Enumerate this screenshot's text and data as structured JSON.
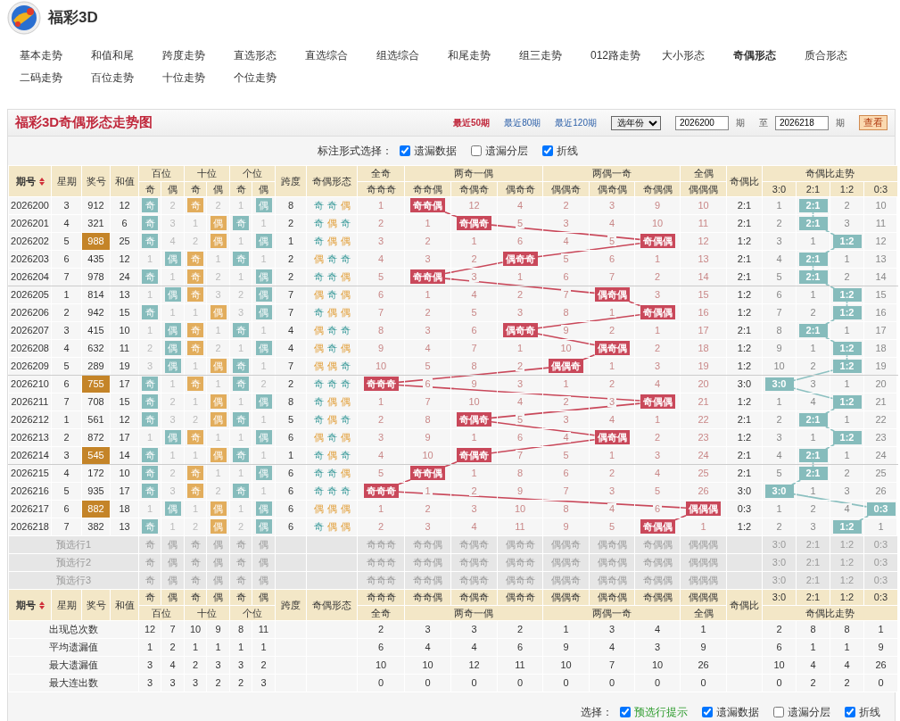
{
  "site": {
    "title": "福彩3D"
  },
  "nav": [
    {
      "label": "基本走势",
      "selected": false
    },
    {
      "label": "和值和尾",
      "selected": false
    },
    {
      "label": "跨度走势",
      "selected": false
    },
    {
      "label": "直选形态",
      "selected": false
    },
    {
      "label": "直选综合",
      "selected": false
    },
    {
      "label": "组选综合",
      "selected": false
    },
    {
      "label": "和尾走势",
      "selected": false
    },
    {
      "label": "组三走势",
      "selected": false
    },
    {
      "label": "012路走势",
      "selected": false
    },
    {
      "label": "大小形态",
      "selected": false
    },
    {
      "label": "奇偶形态",
      "selected": true
    },
    {
      "label": "质合形态",
      "selected": false
    },
    {
      "label": "二码走势",
      "selected": false
    },
    {
      "label": "百位走势",
      "selected": false
    },
    {
      "label": "十位走势",
      "selected": false
    },
    {
      "label": "个位走势",
      "selected": false
    }
  ],
  "panel": {
    "title": "福彩3D奇偶形态走势图",
    "ranges": [
      {
        "label": "最近50期",
        "selected": true
      },
      {
        "label": "最近80期",
        "selected": false
      },
      {
        "label": "最近120期",
        "selected": false
      }
    ],
    "year_select": "选年份",
    "from": "2026200",
    "from_unit": "期",
    "to_label": "至",
    "to": "2026218",
    "to_unit": "期",
    "query_button": "查看"
  },
  "mark_options": {
    "label": "标注形式选择：",
    "options": [
      {
        "kind": "miss",
        "label": "遗漏数据",
        "checked": true
      },
      {
        "kind": "layer",
        "label": "遗漏分层",
        "checked": false
      },
      {
        "kind": "polyline",
        "label": "折线",
        "checked": true
      }
    ]
  },
  "table": {
    "head": {
      "kind": "top",
      "period": "期号",
      "weekday": "星期",
      "number": "奖号",
      "sum": "和值",
      "positions": [
        {
          "label": "百位",
          "cols": [
            "奇",
            "偶"
          ]
        },
        {
          "label": "十位",
          "cols": [
            "奇",
            "偶"
          ]
        },
        {
          "label": "个位",
          "cols": [
            "奇",
            "偶"
          ]
        }
      ],
      "span": "跨度",
      "form": "奇偶形态",
      "groups": [
        {
          "label": "全奇",
          "cols": [
            "奇奇奇"
          ]
        },
        {
          "label": "两奇一偶",
          "cols": [
            "奇奇偶",
            "奇偶奇",
            "偶奇奇"
          ]
        },
        {
          "label": "两偶一奇",
          "cols": [
            "偶偶奇",
            "偶奇偶",
            "奇偶偶"
          ]
        },
        {
          "label": "全偶",
          "cols": [
            "偶偶偶"
          ]
        }
      ],
      "ratio": "奇偶比",
      "trend": {
        "label": "奇偶比走势",
        "cols": [
          "3:0",
          "2:1",
          "1:2",
          "0:3"
        ]
      }
    },
    "rows": [
      {
        "period": "2026200",
        "weekday": "3",
        "number": "912",
        "highlighted": false,
        "sum": "12",
        "digits": [
          "奇",
          "2",
          "奇",
          "2",
          "1",
          "偶"
        ],
        "digit_hits": [
          true,
          false,
          true,
          false,
          false,
          true
        ],
        "span": "8",
        "form": [
          "奇",
          "奇",
          "偶"
        ],
        "form_odd": [
          true,
          true,
          false
        ],
        "shapes": [
          "1",
          "奇奇偶",
          "12",
          "4",
          "2",
          "3",
          "9",
          "10"
        ],
        "shape_hits": [
          false,
          true,
          false,
          false,
          false,
          false,
          false,
          false
        ],
        "ratio": "2:1",
        "trend": [
          "1",
          "2:1",
          "2",
          "10"
        ],
        "trend_hits": [
          false,
          true,
          false,
          false
        ]
      },
      {
        "period": "2026201",
        "weekday": "4",
        "number": "321",
        "highlighted": false,
        "sum": "6",
        "digits": [
          "奇",
          "3",
          "1",
          "偶",
          "奇",
          "1"
        ],
        "digit_hits": [
          true,
          false,
          false,
          true,
          true,
          false
        ],
        "span": "2",
        "form": [
          "奇",
          "偶",
          "奇"
        ],
        "form_odd": [
          true,
          false,
          true
        ],
        "shapes": [
          "2",
          "1",
          "奇偶奇",
          "5",
          "3",
          "4",
          "10",
          "11"
        ],
        "shape_hits": [
          false,
          false,
          true,
          false,
          false,
          false,
          false,
          false
        ],
        "ratio": "2:1",
        "trend": [
          "2",
          "2:1",
          "3",
          "11"
        ],
        "trend_hits": [
          false,
          true,
          false,
          false
        ]
      },
      {
        "period": "2026202",
        "weekday": "5",
        "number": "988",
        "highlighted": true,
        "sum": "25",
        "digits": [
          "奇",
          "4",
          "2",
          "偶",
          "1",
          "偶"
        ],
        "digit_hits": [
          true,
          false,
          false,
          true,
          false,
          true
        ],
        "span": "1",
        "form": [
          "奇",
          "偶",
          "偶"
        ],
        "form_odd": [
          true,
          false,
          false
        ],
        "shapes": [
          "3",
          "2",
          "1",
          "6",
          "4",
          "5",
          "奇偶偶",
          "12"
        ],
        "shape_hits": [
          false,
          false,
          false,
          false,
          false,
          false,
          true,
          false
        ],
        "ratio": "1:2",
        "trend": [
          "3",
          "1",
          "1:2",
          "12"
        ],
        "trend_hits": [
          false,
          false,
          true,
          false
        ]
      },
      {
        "period": "2026203",
        "weekday": "6",
        "number": "435",
        "highlighted": false,
        "sum": "12",
        "digits": [
          "1",
          "偶",
          "奇",
          "1",
          "奇",
          "1"
        ],
        "digit_hits": [
          false,
          true,
          true,
          false,
          true,
          false
        ],
        "span": "2",
        "form": [
          "偶",
          "奇",
          "奇"
        ],
        "form_odd": [
          false,
          true,
          true
        ],
        "shapes": [
          "4",
          "3",
          "2",
          "偶奇奇",
          "5",
          "6",
          "1",
          "13"
        ],
        "shape_hits": [
          false,
          false,
          false,
          true,
          false,
          false,
          false,
          false
        ],
        "ratio": "2:1",
        "trend": [
          "4",
          "2:1",
          "1",
          "13"
        ],
        "trend_hits": [
          false,
          true,
          false,
          false
        ]
      },
      {
        "period": "2026204",
        "weekday": "7",
        "number": "978",
        "highlighted": false,
        "sum": "24",
        "digits": [
          "奇",
          "1",
          "奇",
          "2",
          "1",
          "偶"
        ],
        "digit_hits": [
          true,
          false,
          true,
          false,
          false,
          true
        ],
        "span": "2",
        "form": [
          "奇",
          "奇",
          "偶"
        ],
        "form_odd": [
          true,
          true,
          false
        ],
        "shapes": [
          "5",
          "奇奇偶",
          "3",
          "1",
          "6",
          "7",
          "2",
          "14"
        ],
        "shape_hits": [
          false,
          true,
          false,
          false,
          false,
          false,
          false,
          false
        ],
        "ratio": "2:1",
        "trend": [
          "5",
          "2:1",
          "2",
          "14"
        ],
        "trend_hits": [
          false,
          true,
          false,
          false
        ]
      },
      {
        "period": "2026205",
        "weekday": "1",
        "number": "814",
        "highlighted": false,
        "sum": "13",
        "digits": [
          "1",
          "偶",
          "奇",
          "3",
          "2",
          "偶"
        ],
        "digit_hits": [
          false,
          true,
          true,
          false,
          false,
          true
        ],
        "span": "7",
        "form": [
          "偶",
          "奇",
          "偶"
        ],
        "form_odd": [
          false,
          true,
          false
        ],
        "shapes": [
          "6",
          "1",
          "4",
          "2",
          "7",
          "偶奇偶",
          "3",
          "15"
        ],
        "shape_hits": [
          false,
          false,
          false,
          false,
          false,
          true,
          false,
          false
        ],
        "ratio": "1:2",
        "trend": [
          "6",
          "1",
          "1:2",
          "15"
        ],
        "trend_hits": [
          false,
          false,
          true,
          false
        ]
      },
      {
        "period": "2026206",
        "weekday": "2",
        "number": "942",
        "highlighted": false,
        "sum": "15",
        "digits": [
          "奇",
          "1",
          "1",
          "偶",
          "3",
          "偶"
        ],
        "digit_hits": [
          true,
          false,
          false,
          true,
          false,
          true
        ],
        "span": "7",
        "form": [
          "奇",
          "偶",
          "偶"
        ],
        "form_odd": [
          true,
          false,
          false
        ],
        "shapes": [
          "7",
          "2",
          "5",
          "3",
          "8",
          "1",
          "奇偶偶",
          "16"
        ],
        "shape_hits": [
          false,
          false,
          false,
          false,
          false,
          false,
          true,
          false
        ],
        "ratio": "1:2",
        "trend": [
          "7",
          "2",
          "1:2",
          "16"
        ],
        "trend_hits": [
          false,
          false,
          true,
          false
        ]
      },
      {
        "period": "2026207",
        "weekday": "3",
        "number": "415",
        "highlighted": false,
        "sum": "10",
        "digits": [
          "1",
          "偶",
          "奇",
          "1",
          "奇",
          "1"
        ],
        "digit_hits": [
          false,
          true,
          true,
          false,
          true,
          false
        ],
        "span": "4",
        "form": [
          "偶",
          "奇",
          "奇"
        ],
        "form_odd": [
          false,
          true,
          true
        ],
        "shapes": [
          "8",
          "3",
          "6",
          "偶奇奇",
          "9",
          "2",
          "1",
          "17"
        ],
        "shape_hits": [
          false,
          false,
          false,
          true,
          false,
          false,
          false,
          false
        ],
        "ratio": "2:1",
        "trend": [
          "8",
          "2:1",
          "1",
          "17"
        ],
        "trend_hits": [
          false,
          true,
          false,
          false
        ]
      },
      {
        "period": "2026208",
        "weekday": "4",
        "number": "632",
        "highlighted": false,
        "sum": "11",
        "digits": [
          "2",
          "偶",
          "奇",
          "2",
          "1",
          "偶"
        ],
        "digit_hits": [
          false,
          true,
          true,
          false,
          false,
          true
        ],
        "span": "4",
        "form": [
          "偶",
          "奇",
          "偶"
        ],
        "form_odd": [
          false,
          true,
          false
        ],
        "shapes": [
          "9",
          "4",
          "7",
          "1",
          "10",
          "偶奇偶",
          "2",
          "18"
        ],
        "shape_hits": [
          false,
          false,
          false,
          false,
          false,
          true,
          false,
          false
        ],
        "ratio": "1:2",
        "trend": [
          "9",
          "1",
          "1:2",
          "18"
        ],
        "trend_hits": [
          false,
          false,
          true,
          false
        ]
      },
      {
        "period": "2026209",
        "weekday": "5",
        "number": "289",
        "highlighted": false,
        "sum": "19",
        "digits": [
          "3",
          "偶",
          "1",
          "偶",
          "奇",
          "1"
        ],
        "digit_hits": [
          false,
          true,
          false,
          true,
          true,
          false
        ],
        "span": "7",
        "form": [
          "偶",
          "偶",
          "奇"
        ],
        "form_odd": [
          false,
          false,
          true
        ],
        "shapes": [
          "10",
          "5",
          "8",
          "2",
          "偶偶奇",
          "1",
          "3",
          "19"
        ],
        "shape_hits": [
          false,
          false,
          false,
          false,
          true,
          false,
          false,
          false
        ],
        "ratio": "1:2",
        "trend": [
          "10",
          "2",
          "1:2",
          "19"
        ],
        "trend_hits": [
          false,
          false,
          true,
          false
        ]
      },
      {
        "period": "2026210",
        "weekday": "6",
        "number": "755",
        "highlighted": true,
        "sum": "17",
        "digits": [
          "奇",
          "1",
          "奇",
          "1",
          "奇",
          "2"
        ],
        "digit_hits": [
          true,
          false,
          true,
          false,
          true,
          false
        ],
        "span": "2",
        "form": [
          "奇",
          "奇",
          "奇"
        ],
        "form_odd": [
          true,
          true,
          true
        ],
        "shapes": [
          "奇奇奇",
          "6",
          "9",
          "3",
          "1",
          "2",
          "4",
          "20"
        ],
        "shape_hits": [
          true,
          false,
          false,
          false,
          false,
          false,
          false,
          false
        ],
        "ratio": "3:0",
        "trend": [
          "3:0",
          "3",
          "1",
          "20"
        ],
        "trend_hits": [
          true,
          false,
          false,
          false
        ]
      },
      {
        "period": "2026211",
        "weekday": "7",
        "number": "708",
        "highlighted": false,
        "sum": "15",
        "digits": [
          "奇",
          "2",
          "1",
          "偶",
          "1",
          "偶"
        ],
        "digit_hits": [
          true,
          false,
          false,
          true,
          false,
          true
        ],
        "span": "8",
        "form": [
          "奇",
          "偶",
          "偶"
        ],
        "form_odd": [
          true,
          false,
          false
        ],
        "shapes": [
          "1",
          "7",
          "10",
          "4",
          "2",
          "3",
          "奇偶偶",
          "21"
        ],
        "shape_hits": [
          false,
          false,
          false,
          false,
          false,
          false,
          true,
          false
        ],
        "ratio": "1:2",
        "trend": [
          "1",
          "4",
          "1:2",
          "21"
        ],
        "trend_hits": [
          false,
          false,
          true,
          false
        ]
      },
      {
        "period": "2026212",
        "weekday": "1",
        "number": "561",
        "highlighted": false,
        "sum": "12",
        "digits": [
          "奇",
          "3",
          "2",
          "偶",
          "奇",
          "1"
        ],
        "digit_hits": [
          true,
          false,
          false,
          true,
          true,
          false
        ],
        "span": "5",
        "form": [
          "奇",
          "偶",
          "奇"
        ],
        "form_odd": [
          true,
          false,
          true
        ],
        "shapes": [
          "2",
          "8",
          "奇偶奇",
          "5",
          "3",
          "4",
          "1",
          "22"
        ],
        "shape_hits": [
          false,
          false,
          true,
          false,
          false,
          false,
          false,
          false
        ],
        "ratio": "2:1",
        "trend": [
          "2",
          "2:1",
          "1",
          "22"
        ],
        "trend_hits": [
          false,
          true,
          false,
          false
        ]
      },
      {
        "period": "2026213",
        "weekday": "2",
        "number": "872",
        "highlighted": false,
        "sum": "17",
        "digits": [
          "1",
          "偶",
          "奇",
          "1",
          "1",
          "偶"
        ],
        "digit_hits": [
          false,
          true,
          true,
          false,
          false,
          true
        ],
        "span": "6",
        "form": [
          "偶",
          "奇",
          "偶"
        ],
        "form_odd": [
          false,
          true,
          false
        ],
        "shapes": [
          "3",
          "9",
          "1",
          "6",
          "4",
          "偶奇偶",
          "2",
          "23"
        ],
        "shape_hits": [
          false,
          false,
          false,
          false,
          false,
          true,
          false,
          false
        ],
        "ratio": "1:2",
        "trend": [
          "3",
          "1",
          "1:2",
          "23"
        ],
        "trend_hits": [
          false,
          false,
          true,
          false
        ]
      },
      {
        "period": "2026214",
        "weekday": "3",
        "number": "545",
        "highlighted": true,
        "sum": "14",
        "digits": [
          "奇",
          "1",
          "1",
          "偶",
          "奇",
          "1"
        ],
        "digit_hits": [
          true,
          false,
          false,
          true,
          true,
          false
        ],
        "span": "1",
        "form": [
          "奇",
          "偶",
          "奇"
        ],
        "form_odd": [
          true,
          false,
          true
        ],
        "shapes": [
          "4",
          "10",
          "奇偶奇",
          "7",
          "5",
          "1",
          "3",
          "24"
        ],
        "shape_hits": [
          false,
          false,
          true,
          false,
          false,
          false,
          false,
          false
        ],
        "ratio": "2:1",
        "trend": [
          "4",
          "2:1",
          "1",
          "24"
        ],
        "trend_hits": [
          false,
          true,
          false,
          false
        ]
      },
      {
        "period": "2026215",
        "weekday": "4",
        "number": "172",
        "highlighted": false,
        "sum": "10",
        "digits": [
          "奇",
          "2",
          "奇",
          "1",
          "1",
          "偶"
        ],
        "digit_hits": [
          true,
          false,
          true,
          false,
          false,
          true
        ],
        "span": "6",
        "form": [
          "奇",
          "奇",
          "偶"
        ],
        "form_odd": [
          true,
          true,
          false
        ],
        "shapes": [
          "5",
          "奇奇偶",
          "1",
          "8",
          "6",
          "2",
          "4",
          "25"
        ],
        "shape_hits": [
          false,
          true,
          false,
          false,
          false,
          false,
          false,
          false
        ],
        "ratio": "2:1",
        "trend": [
          "5",
          "2:1",
          "2",
          "25"
        ],
        "trend_hits": [
          false,
          true,
          false,
          false
        ]
      },
      {
        "period": "2026216",
        "weekday": "5",
        "number": "935",
        "highlighted": false,
        "sum": "17",
        "digits": [
          "奇",
          "3",
          "奇",
          "2",
          "奇",
          "1"
        ],
        "digit_hits": [
          true,
          false,
          true,
          false,
          true,
          false
        ],
        "span": "6",
        "form": [
          "奇",
          "奇",
          "奇"
        ],
        "form_odd": [
          true,
          true,
          true
        ],
        "shapes": [
          "奇奇奇",
          "1",
          "2",
          "9",
          "7",
          "3",
          "5",
          "26"
        ],
        "shape_hits": [
          true,
          false,
          false,
          false,
          false,
          false,
          false,
          false
        ],
        "ratio": "3:0",
        "trend": [
          "3:0",
          "1",
          "3",
          "26"
        ],
        "trend_hits": [
          true,
          false,
          false,
          false
        ]
      },
      {
        "period": "2026217",
        "weekday": "6",
        "number": "882",
        "highlighted": true,
        "sum": "18",
        "digits": [
          "1",
          "偶",
          "1",
          "偶",
          "1",
          "偶"
        ],
        "digit_hits": [
          false,
          true,
          false,
          true,
          false,
          true
        ],
        "span": "6",
        "form": [
          "偶",
          "偶",
          "偶"
        ],
        "form_odd": [
          false,
          false,
          false
        ],
        "shapes": [
          "1",
          "2",
          "3",
          "10",
          "8",
          "4",
          "6",
          "偶偶偶"
        ],
        "shape_hits": [
          false,
          false,
          false,
          false,
          false,
          false,
          false,
          true
        ],
        "ratio": "0:3",
        "trend": [
          "1",
          "2",
          "4",
          "0:3"
        ],
        "trend_hits": [
          false,
          false,
          false,
          true
        ]
      },
      {
        "period": "2026218",
        "weekday": "7",
        "number": "382",
        "highlighted": false,
        "sum": "13",
        "digits": [
          "奇",
          "1",
          "2",
          "偶",
          "2",
          "偶"
        ],
        "digit_hits": [
          true,
          false,
          false,
          true,
          false,
          true
        ],
        "span": "6",
        "form": [
          "奇",
          "偶",
          "偶"
        ],
        "form_odd": [
          true,
          false,
          false
        ],
        "shapes": [
          "2",
          "3",
          "4",
          "11",
          "9",
          "5",
          "奇偶偶",
          "1"
        ],
        "shape_hits": [
          false,
          false,
          false,
          false,
          false,
          false,
          true,
          false
        ],
        "ratio": "1:2",
        "trend": [
          "2",
          "3",
          "1:2",
          "1"
        ],
        "trend_hits": [
          false,
          false,
          true,
          false
        ]
      }
    ],
    "prefill_rows": [
      {
        "label": "预选行1",
        "digits": [
          "奇",
          "偶",
          "奇",
          "偶",
          "奇",
          "偶"
        ],
        "shapes": [
          "奇奇奇",
          "奇奇偶",
          "奇偶奇",
          "偶奇奇",
          "偶偶奇",
          "偶奇偶",
          "奇偶偶",
          "偶偶偶"
        ],
        "trend": [
          "3:0",
          "2:1",
          "1:2",
          "0:3"
        ]
      },
      {
        "label": "预选行2",
        "digits": [
          "奇",
          "偶",
          "奇",
          "偶",
          "奇",
          "偶"
        ],
        "shapes": [
          "奇奇奇",
          "奇奇偶",
          "奇偶奇",
          "偶奇奇",
          "偶偶奇",
          "偶奇偶",
          "奇偶偶",
          "偶偶偶"
        ],
        "trend": [
          "3:0",
          "2:1",
          "1:2",
          "0:3"
        ]
      },
      {
        "label": "预选行3",
        "digits": [
          "奇",
          "偶",
          "奇",
          "偶",
          "奇",
          "偶"
        ],
        "shapes": [
          "奇奇奇",
          "奇奇偶",
          "奇偶奇",
          "偶奇奇",
          "偶偶奇",
          "偶奇偶",
          "奇偶偶",
          "偶偶偶"
        ],
        "trend": [
          "3:0",
          "2:1",
          "1:2",
          "0:3"
        ]
      }
    ],
    "foot_head": {
      "kind": "bottom",
      "period": "期号",
      "weekday": "星期",
      "number": "奖号",
      "sum": "和值",
      "positions": [
        {
          "label": "百位",
          "cols": [
            "奇",
            "偶"
          ]
        },
        {
          "label": "十位",
          "cols": [
            "奇",
            "偶"
          ]
        },
        {
          "label": "个位",
          "cols": [
            "奇",
            "偶"
          ]
        }
      ],
      "span": "跨度",
      "form": "奇偶形态",
      "groups": [
        {
          "label": "全奇",
          "cols": [
            "奇奇奇"
          ]
        },
        {
          "label": "两奇一偶",
          "cols": [
            "奇奇偶",
            "奇偶奇",
            "偶奇奇"
          ]
        },
        {
          "label": "两偶一奇",
          "cols": [
            "偶偶奇",
            "偶奇偶",
            "奇偶偶"
          ]
        },
        {
          "label": "全偶",
          "cols": [
            "偶偶偶"
          ]
        }
      ],
      "ratio": "奇偶比",
      "trend": {
        "label": "奇偶比走势",
        "cols": [
          "3:0",
          "2:1",
          "1:2",
          "0:3"
        ]
      }
    },
    "stats": [
      {
        "label": "出现总次数",
        "digits": [
          "12",
          "7",
          "10",
          "9",
          "8",
          "11"
        ],
        "shapes": [
          "2",
          "3",
          "3",
          "2",
          "1",
          "3",
          "4",
          "1"
        ],
        "trend": [
          "2",
          "8",
          "8",
          "1"
        ]
      },
      {
        "label": "平均遗漏值",
        "digits": [
          "1",
          "2",
          "1",
          "1",
          "1",
          "1"
        ],
        "shapes": [
          "6",
          "4",
          "4",
          "6",
          "9",
          "4",
          "3",
          "9"
        ],
        "trend": [
          "6",
          "1",
          "1",
          "9"
        ]
      },
      {
        "label": "最大遗漏值",
        "digits": [
          "3",
          "4",
          "2",
          "3",
          "3",
          "2"
        ],
        "shapes": [
          "10",
          "10",
          "12",
          "11",
          "10",
          "7",
          "10",
          "26"
        ],
        "trend": [
          "10",
          "4",
          "4",
          "26"
        ]
      },
      {
        "label": "最大连出数",
        "digits": [
          "3",
          "3",
          "3",
          "2",
          "2",
          "3"
        ],
        "shapes": [
          "0",
          "0",
          "0",
          "0",
          "0",
          "0",
          "0",
          "0"
        ],
        "trend": [
          "0",
          "2",
          "2",
          "0"
        ]
      }
    ]
  },
  "bottom_options": {
    "label": "选择：",
    "options": [
      {
        "kind": "prefill",
        "label": "预选行提示",
        "checked": true
      },
      {
        "kind": "miss",
        "label": "遗漏数据",
        "checked": true
      },
      {
        "kind": "layer",
        "label": "遗漏分层",
        "checked": false
      },
      {
        "kind": "polyline",
        "label": "折线",
        "checked": true
      }
    ]
  }
}
